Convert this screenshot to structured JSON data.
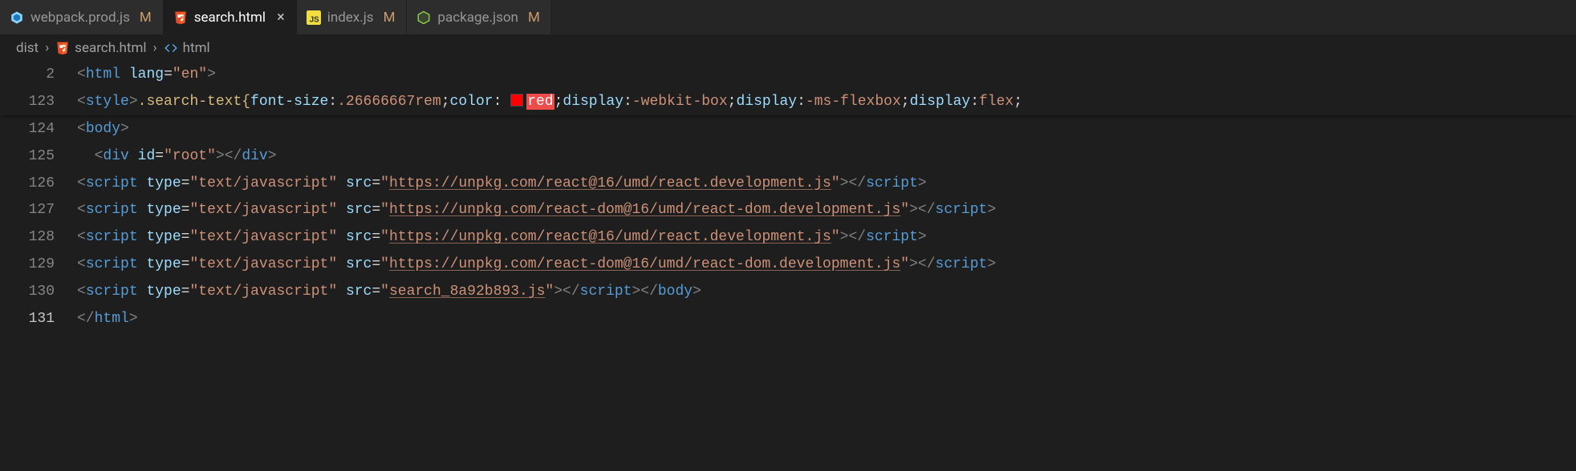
{
  "tabs": [
    {
      "icon": "webpack-icon",
      "label": "webpack.prod.js",
      "modified": "M",
      "active": false,
      "close": ""
    },
    {
      "icon": "html-icon",
      "label": "search.html",
      "modified": "",
      "active": true,
      "close": "×"
    },
    {
      "icon": "js-icon",
      "label": "index.js",
      "modified": "M",
      "active": false,
      "close": ""
    },
    {
      "icon": "nodejs-icon",
      "label": "package.json",
      "modified": "M",
      "active": false,
      "close": ""
    }
  ],
  "breadcrumbs": {
    "folder": "dist",
    "file": "search.html",
    "symbol": "html"
  },
  "lines": {
    "l0": {
      "num": "2"
    },
    "l1": {
      "num": "123"
    },
    "l2": {
      "num": "124"
    },
    "l3": {
      "num": "125"
    },
    "l4": {
      "num": "126"
    },
    "l5": {
      "num": "127"
    },
    "l6": {
      "num": "128"
    },
    "l7": {
      "num": "129"
    },
    "l8": {
      "num": "130"
    },
    "l9": {
      "num": "131"
    }
  },
  "tok": {
    "lt": "<",
    "gt": ">",
    "lts": "</",
    "eq": "=",
    "q": "\"",
    "sp": " ",
    "sp2": "  ",
    "html": "html",
    "lang": "lang",
    "en": "en",
    "style": "style",
    "body": "body",
    "div": "div",
    "id": "id",
    "root": "root",
    "script": "script",
    "type": "type",
    "textjs": "text/javascript",
    "src": "src",
    "react_dev": "https://unpkg.com/react@16/umd/react.development.js",
    "reactdom_dev": "https://unpkg.com/react-dom@16/umd/react-dom.development.js",
    "search_js": "search_8a92b893.js",
    "css_sel": ".search-text",
    "brace_o": "{",
    "brace_c": "}",
    "css": {
      "font_size": "font-size",
      "color": "color",
      "display": "display",
      "v_fs": ".26666667rem",
      "v_red": "red",
      "v_webkitbox": "-webkit-box",
      "v_msflexbox": "-ms-flexbox",
      "v_flex": "flex",
      "colon": ":",
      "semi": ";",
      "sp": " "
    }
  }
}
